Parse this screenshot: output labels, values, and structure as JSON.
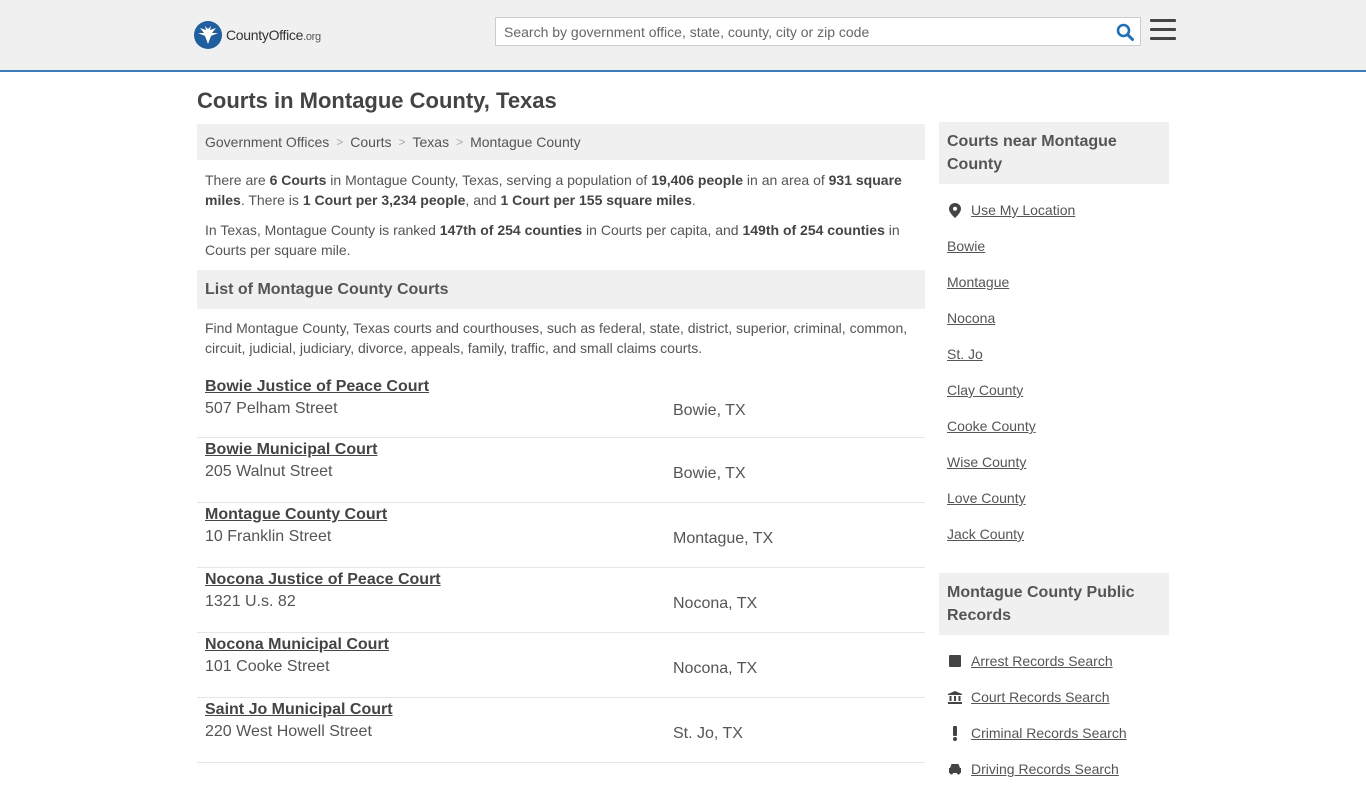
{
  "header": {
    "logo_name": "County",
    "logo_name_bold": "Office",
    "logo_tld": ".org",
    "search_placeholder": "Search by government office, state, county, city or zip code"
  },
  "page_title": "Courts in Montague County, Texas",
  "breadcrumb": [
    "Government Offices",
    "Courts",
    "Texas",
    "Montague County"
  ],
  "summary": {
    "p1": {
      "a": "There are ",
      "b1": "6 Courts",
      "c": " in Montague County, Texas, serving a population of ",
      "b2": "19,406 people",
      "d": " in an area of ",
      "b3": "931 square miles",
      "e": ". There is ",
      "b4": "1 Court per 3,234 people",
      "f": ", and ",
      "b5": "1 Court per 155 square miles",
      "g": "."
    },
    "p2": {
      "a": "In Texas, Montague County is ranked ",
      "b1": "147th of 254 counties",
      "c": " in Courts per capita, and ",
      "b2": "149th of 254 counties",
      "d": " in Courts per square mile."
    }
  },
  "list": {
    "heading": "List of Montague County Courts",
    "intro": "Find Montague County, Texas courts and courthouses, such as federal, state, district, superior, criminal, common, circuit, judicial, judiciary, divorce, appeals, family, traffic, and small claims courts.",
    "courts": [
      {
        "name": "Bowie Justice of Peace Court",
        "address": "507 Pelham Street",
        "city": "Bowie, TX"
      },
      {
        "name": "Bowie Municipal Court",
        "address": "205 Walnut Street",
        "city": "Bowie, TX"
      },
      {
        "name": "Montague County Court",
        "address": "10 Franklin Street",
        "city": "Montague, TX"
      },
      {
        "name": "Nocona Justice of Peace Court",
        "address": "1321 U.s. 82",
        "city": "Nocona, TX"
      },
      {
        "name": "Nocona Municipal Court",
        "address": "101 Cooke Street",
        "city": "Nocona, TX"
      },
      {
        "name": "Saint Jo Municipal Court",
        "address": "220 West Howell Street",
        "city": "St. Jo, TX"
      }
    ]
  },
  "sidebar": {
    "nearby_heading": "Courts near Montague County",
    "use_location": "Use My Location",
    "nearby": [
      "Bowie",
      "Montague",
      "Nocona",
      "St. Jo",
      "Clay County",
      "Cooke County",
      "Wise County",
      "Love County",
      "Jack County"
    ],
    "records_heading": "Montague County Public Records",
    "records": [
      "Arrest Records Search",
      "Court Records Search",
      "Criminal Records Search",
      "Driving Records Search"
    ]
  },
  "colors": {
    "accent": "#3d7ab8",
    "logo": "#1f5f9e",
    "search_icon": "#1f6fb5"
  }
}
